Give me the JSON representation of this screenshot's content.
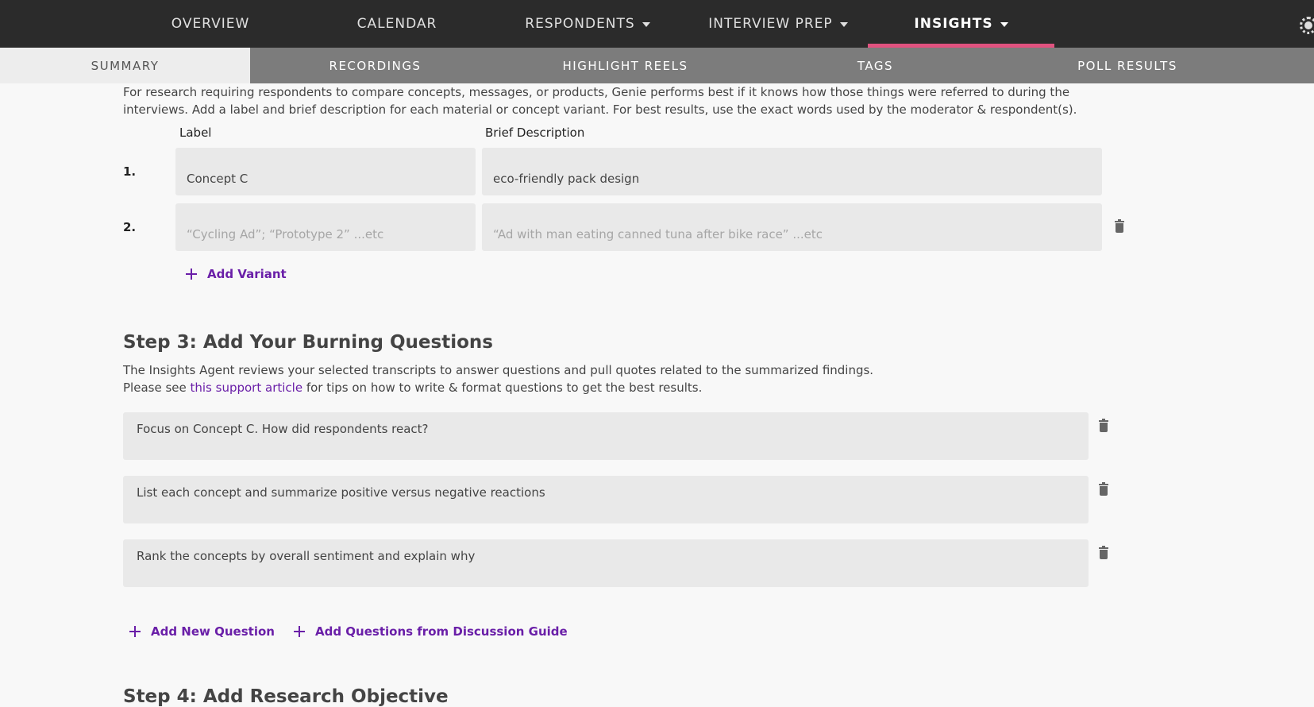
{
  "topnav": {
    "items": [
      {
        "label": "OVERVIEW"
      },
      {
        "label": "CALENDAR"
      },
      {
        "label": "RESPONDENTS"
      },
      {
        "label": "INTERVIEW PREP"
      },
      {
        "label": "INSIGHTS"
      }
    ],
    "active_index": 4,
    "accent_color": "#e0527f"
  },
  "subnav": {
    "tabs": [
      {
        "label": "SUMMARY"
      },
      {
        "label": "RECORDINGS"
      },
      {
        "label": "HIGHLIGHT REELS"
      },
      {
        "label": "TAGS"
      },
      {
        "label": "POLL RESULTS"
      }
    ],
    "active_index": 0
  },
  "variants": {
    "intro_line1": "For research requiring respondents to compare concepts, messages, or products, Genie performs best if it knows how those things were referred to during the",
    "intro_line2": "interviews. Add a label and brief description for each material or concept variant. For best results, use the exact words used by the moderator & respondent(s).",
    "label_header": "Label",
    "description_header": "Brief Description",
    "rows": [
      {
        "number": "1.",
        "label": "Concept C",
        "description": "eco-friendly pack design"
      },
      {
        "number": "2.",
        "label_placeholder": "“Cycling Ad”; “Prototype 2” ...etc",
        "description_placeholder": "“Ad with man eating canned tuna after bike race” ...etc"
      }
    ],
    "add_label": "Add Variant"
  },
  "step3": {
    "title": "Step 3: Add Your Burning Questions",
    "desc_line1": "The Insights Agent reviews your selected transcripts to answer questions and pull quotes related to the summarized findings.",
    "desc_line2_pre": "Please see ",
    "desc_link": "this support article",
    "desc_line2_post": " for tips on how to write & format questions to get the best results.",
    "questions": [
      "Focus on Concept C. How did respondents react?",
      "List each concept and summarize positive versus negative reactions",
      "Rank the concepts by overall sentiment and explain why"
    ],
    "add_question": "Add New Question",
    "add_from_guide": "Add Questions from Discussion Guide",
    "link_color": "#6a1fa8"
  },
  "step4": {
    "title": "Step 4: Add Research Objective"
  }
}
